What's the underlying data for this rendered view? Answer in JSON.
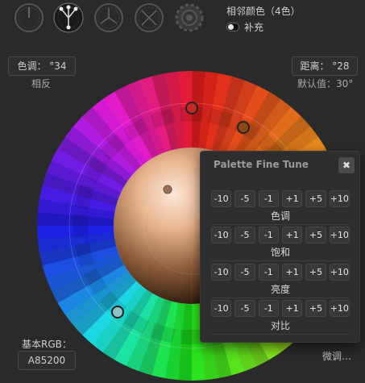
{
  "header": {
    "title": "相邻颜色（4色）",
    "complement_label": "补充"
  },
  "hue_field": {
    "label": "色调：",
    "value": "°34"
  },
  "hue_caption": "相反",
  "distance_field": {
    "label": "距离：",
    "value": "°28"
  },
  "distance_caption": "默认值：30°",
  "base_rgb": {
    "label": "基本RGB：",
    "value": "A85200"
  },
  "fine_tune_link": "微调…",
  "panel": {
    "title": "Palette Fine Tune",
    "close_icon": "close-icon",
    "buttons": [
      "-10",
      "-5",
      "-1",
      "+1",
      "+5",
      "+10"
    ],
    "rows": [
      "色调",
      "饱和",
      "亮度",
      "对比"
    ]
  },
  "mode_icons": [
    "mono-icon",
    "analogous-icon",
    "triad-icon",
    "tetrad-icon",
    "custom-gear-icon"
  ],
  "colors": {
    "background": "#2a2a2a",
    "panel": "#2e2e2e",
    "text": "#c8c8c8"
  }
}
